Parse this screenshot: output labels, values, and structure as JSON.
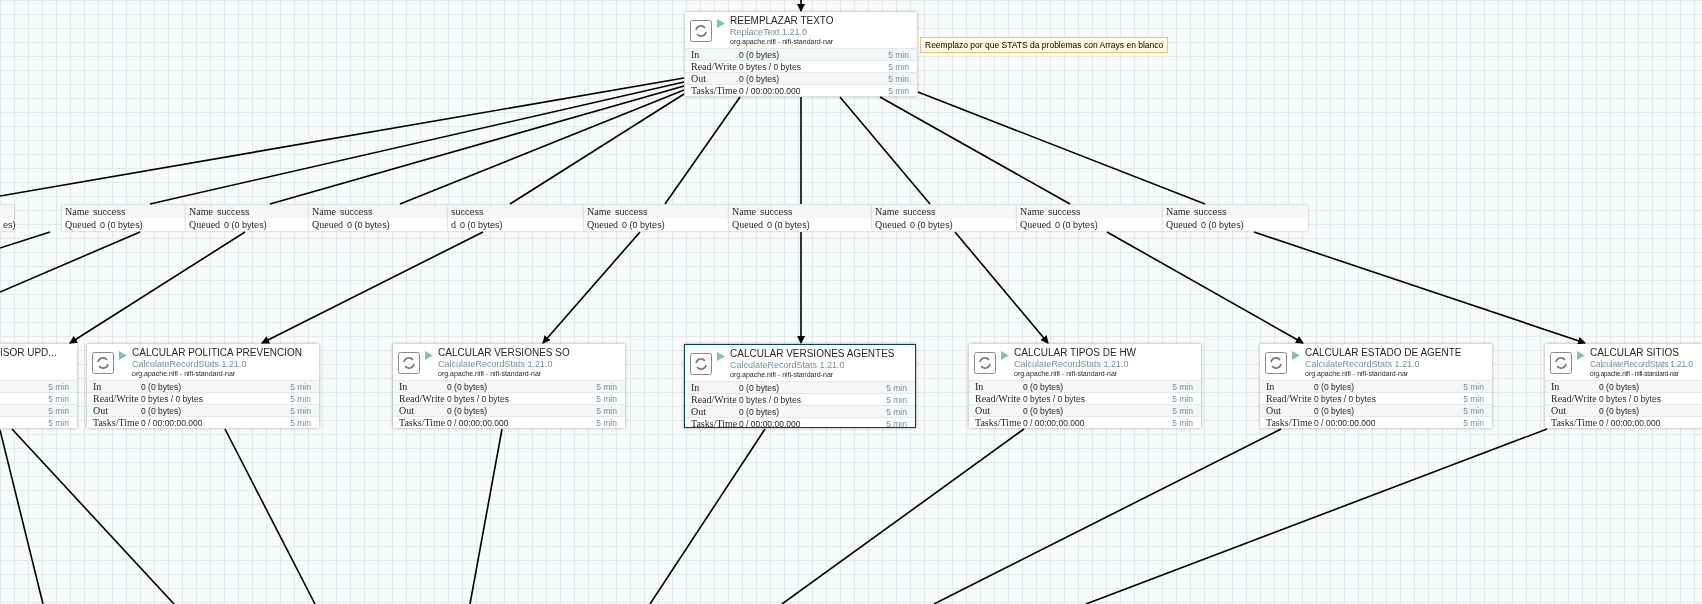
{
  "canvas": {
    "processors": [
      {
        "kind": "full",
        "name": "REEMPLAZAR TEXTO",
        "type": "ReplaceText 1.21.0",
        "bundle": "org.apache.nifi - nifi-standard-nar",
        "selected": false,
        "comment": "Reemplazo por que STATS da problemas con Arrays en blanco",
        "stats": [
          {
            "label": "In",
            "value": "0 (0 bytes)",
            "time": "5 min"
          },
          {
            "label": "Read/Write",
            "value": "0 bytes / 0 bytes",
            "time": "5 min"
          },
          {
            "label": "Out",
            "value": "0 (0 bytes)",
            "time": "5 min"
          },
          {
            "label": "Tasks/Time",
            "value": "0 / 00:00:00.000",
            "time": "5 min"
          }
        ]
      },
      {
        "kind": "clipped-left",
        "name": "ISOR UPD...",
        "selected": false,
        "stats": [
          {
            "time": "5 min"
          },
          {
            "time": "5 min"
          },
          {
            "time": "5 min"
          },
          {
            "time": "5 min"
          }
        ]
      },
      {
        "kind": "full",
        "name": "CALCULAR POLITICA PREVENCION",
        "type": "CalculateRecordStats 1.21.0",
        "bundle": "org.apache.nifi - nifi-standard-nar",
        "selected": false,
        "stats": [
          {
            "label": "In",
            "value": "0 (0 bytes)",
            "time": "5 min"
          },
          {
            "label": "Read/Write",
            "value": "0 bytes / 0 bytes",
            "time": "5 min"
          },
          {
            "label": "Out",
            "value": "0 (0 bytes)",
            "time": "5 min"
          },
          {
            "label": "Tasks/Time",
            "value": "0 / 00:00:00.000",
            "time": "5 min"
          }
        ]
      },
      {
        "kind": "full",
        "name": "CALCULAR VERSIONES SO",
        "type": "CalculateRecordStats 1.21.0",
        "bundle": "org.apache.nifi - nifi-standard-nar",
        "selected": false,
        "stats": [
          {
            "label": "In",
            "value": "0 (0 bytes)",
            "time": "5 min"
          },
          {
            "label": "Read/Write",
            "value": "0 bytes / 0 bytes",
            "time": "5 min"
          },
          {
            "label": "Out",
            "value": "0 (0 bytes)",
            "time": "5 min"
          },
          {
            "label": "Tasks/Time",
            "value": "0 / 00:00:00.000",
            "time": "5 min"
          }
        ]
      },
      {
        "kind": "full",
        "name": "CALCULAR VERSIONES AGENTES",
        "type": "CalculateRecordStats 1.21.0",
        "bundle": "org.apache.nifi - nifi-standard-nar",
        "selected": true,
        "stats": [
          {
            "label": "In",
            "value": "0 (0 bytes)",
            "time": "5 min"
          },
          {
            "label": "Read/Write",
            "value": "0 bytes / 0 bytes",
            "time": "5 min"
          },
          {
            "label": "Out",
            "value": "0 (0 bytes)",
            "time": "5 min"
          },
          {
            "label": "Tasks/Time",
            "value": "0 / 00:00:00.000",
            "time": "5 min"
          }
        ]
      },
      {
        "kind": "full",
        "name": "CALCULAR TIPOS DE HW",
        "type": "CalculateRecordStats 1.21.0",
        "bundle": "org.apache.nifi - nifi-standard-nar",
        "selected": false,
        "stats": [
          {
            "label": "In",
            "value": "0 (0 bytes)",
            "time": "5 min"
          },
          {
            "label": "Read/Write",
            "value": "0 bytes / 0 bytes",
            "time": "5 min"
          },
          {
            "label": "Out",
            "value": "0 (0 bytes)",
            "time": "5 min"
          },
          {
            "label": "Tasks/Time",
            "value": "0 / 00:00:00.000",
            "time": "5 min"
          }
        ]
      },
      {
        "kind": "full",
        "name": "CALCULAR ESTADO DE AGENTE",
        "type": "CalculateRecordStats 1.21.0",
        "bundle": "org.apache.nifi - nifi-standard-nar",
        "selected": false,
        "stats": [
          {
            "label": "In",
            "value": "0 (0 bytes)",
            "time": "5 min"
          },
          {
            "label": "Read/Write",
            "value": "0 bytes / 0 bytes",
            "time": "5 min"
          },
          {
            "label": "Out",
            "value": "0 (0 bytes)",
            "time": "5 min"
          },
          {
            "label": "Tasks/Time",
            "value": "0 / 00:00:00.000",
            "time": "5 min"
          }
        ]
      },
      {
        "kind": "clipped-right",
        "name": "CALCULAR SITIOS",
        "type": "CalculateRecordStats 1.21.0",
        "bundle": "org.apache.nifi - nifi-standard-nar",
        "selected": false,
        "stats": [
          {
            "label": "In",
            "value": "0 (0 bytes)"
          },
          {
            "label": "Read/Write",
            "value": "0 bytes / 0 bytes"
          },
          {
            "label": "Out",
            "value": "0 (0 bytes)"
          },
          {
            "label": "Tasks/Time",
            "value": "0 / 00:00:00.000"
          }
        ]
      }
    ],
    "connections": [
      {
        "queued": "es)"
      },
      {
        "name_key": "Name",
        "name": "success",
        "queued_key": "Queued",
        "queued": "0 (0 bytes)"
      },
      {
        "name_key": "Name",
        "name": "success",
        "queued_key": "Queued",
        "queued": "0 (0 bytes)"
      },
      {
        "name_key": "Name",
        "name": "success",
        "queued_key": "Queued",
        "queued": "0 (0 bytes)"
      },
      {
        "name": "success",
        "queued_key": "d",
        "queued": "0 (0 bytes)"
      },
      {
        "name_key": "Name",
        "name": "success",
        "queued_key": "Queued",
        "queued": "0 (0 bytes)"
      },
      {
        "name_key": "Name",
        "name": "success",
        "queued_key": "Queued",
        "queued": "0 (0 bytes)"
      },
      {
        "name_key": "Name",
        "name": "success",
        "queued_key": "Queued",
        "queued": "0 (0 bytes)"
      },
      {
        "name_key": "Name",
        "name": "success",
        "queued_key": "Queued",
        "queued": "0 (0 bytes)"
      },
      {
        "name_key": "Name",
        "name": "success",
        "queued_key": "Queued",
        "queued": "0 (0 bytes)"
      }
    ]
  }
}
